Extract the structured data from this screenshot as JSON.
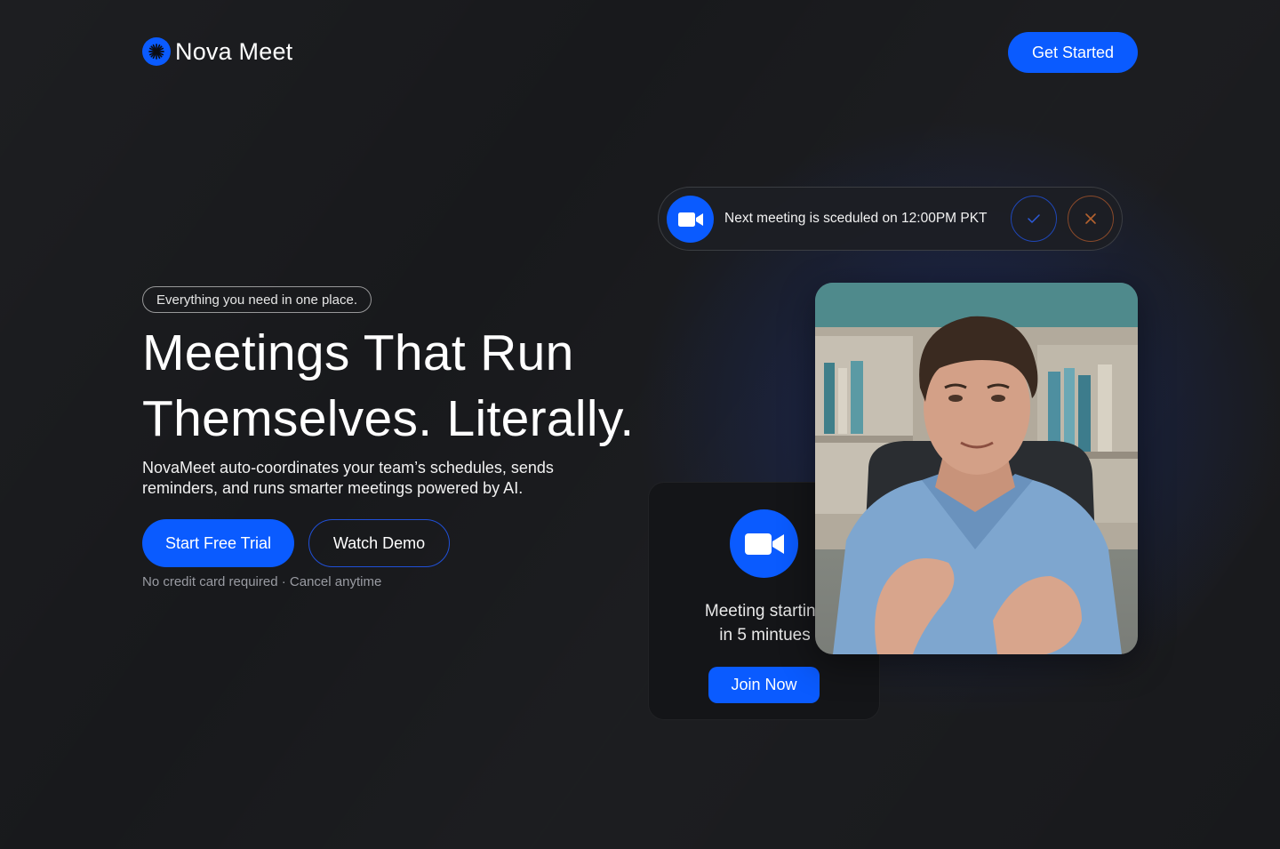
{
  "header": {
    "brand_name": "Nova Meet",
    "cta_label": "Get Started"
  },
  "hero": {
    "pill_text": "Everything you need in one place.",
    "headline_line1": "Meetings That Run",
    "headline_line2": "Themselves. Literally.",
    "subtext": "NovaMeet auto-coordinates your team’s schedules, sends reminders, and runs smarter meetings powered by AI.",
    "primary_cta": "Start Free Trial",
    "secondary_cta": "Watch Demo",
    "fineprint": "No credit card required · Cancel anytime"
  },
  "notification": {
    "text": "Next meeting is sceduled on 12:00PM PKT",
    "icon": "video-camera-icon",
    "accept_icon": "check-icon",
    "decline_icon": "close-icon"
  },
  "meeting_card": {
    "icon": "video-camera-icon",
    "line1": "Meeting starting",
    "line2": "in 5 mintues",
    "join_label": "Join Now"
  },
  "colors": {
    "background": "#18191c",
    "accent": "#0a5bff",
    "accept_ring": "#1f47b8",
    "decline_ring": "#8a4a2a",
    "muted_text": "#9a9ca3"
  }
}
